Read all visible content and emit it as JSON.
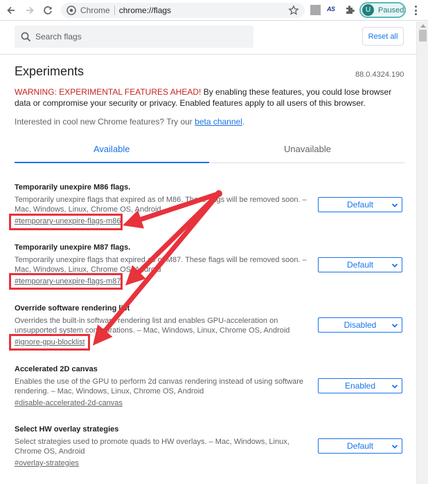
{
  "browser": {
    "omnibox_chip": "Chrome",
    "url": "chrome://flags",
    "extension_label": "AS",
    "profile_initial": "U",
    "profile_status": "Paused"
  },
  "header": {
    "search_placeholder": "Search flags",
    "reset_label": "Reset all"
  },
  "page": {
    "title": "Experiments",
    "version": "88.0.4324.190",
    "warning_strong": "WARNING: EXPERIMENTAL FEATURES AHEAD!",
    "warning_rest": " By enabling these features, you could lose browser data or compromise your security or privacy. Enabled features apply to all users of this browser.",
    "interest_text": "Interested in cool new Chrome features? Try our ",
    "interest_link": "beta channel",
    "interest_end": "."
  },
  "tabs": [
    {
      "label": "Available",
      "active": true
    },
    {
      "label": "Unavailable",
      "active": false
    }
  ],
  "flags": [
    {
      "title": "Temporarily unexpire M86 flags.",
      "description": "Temporarily unexpire flags that expired as of M86. These flags will be removed soon. – Mac, Windows, Linux, Chrome OS, Android",
      "link": "#temporary-unexpire-flags-m86",
      "value": "Default"
    },
    {
      "title": "Temporarily unexpire M87 flags.",
      "description": "Temporarily unexpire flags that expired as of M87. These flags will be removed soon. – Mac, Windows, Linux, Chrome OS, Android",
      "link": "#temporary-unexpire-flags-m87",
      "value": "Default"
    },
    {
      "title": "Override software rendering list",
      "description": "Overrides the built-in software rendering list and enables GPU-acceleration on unsupported system configurations. – Mac, Windows, Linux, Chrome OS, Android",
      "link": "#ignore-gpu-blocklist",
      "value": "Disabled"
    },
    {
      "title": "Accelerated 2D canvas",
      "description": "Enables the use of the GPU to perform 2d canvas rendering instead of using software rendering. – Mac, Windows, Linux, Chrome OS, Android",
      "link": "#disable-accelerated-2d-canvas",
      "value": "Enabled"
    },
    {
      "title": "Select HW overlay strategies",
      "description": "Select strategies used to promote quads to HW overlays. – Mac, Windows, Linux, Chrome OS, Android",
      "link": "#overlay-strategies",
      "value": "Default"
    }
  ],
  "colors": {
    "accent": "#1a73e8",
    "warning": "#c5221f",
    "annotation": "#e8323c"
  }
}
